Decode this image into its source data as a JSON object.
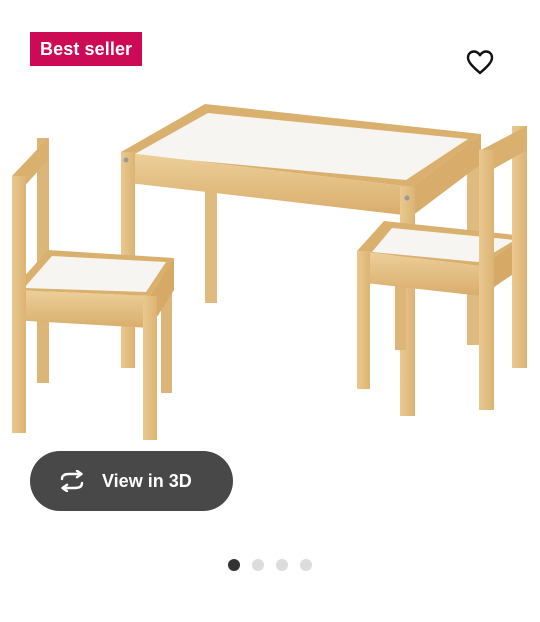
{
  "badge": {
    "label": "Best seller",
    "color": "#cc0a55"
  },
  "favorite": {
    "icon": "heart-icon"
  },
  "view3d": {
    "label": "View in 3D",
    "icon": "rotate-3d-icon",
    "background": "#484848"
  },
  "carousel": {
    "total": 4,
    "active_index": 0
  },
  "colors": {
    "wood": "#e8c48a",
    "wood_dark": "#d4a860",
    "top": "#f7f7f5"
  }
}
